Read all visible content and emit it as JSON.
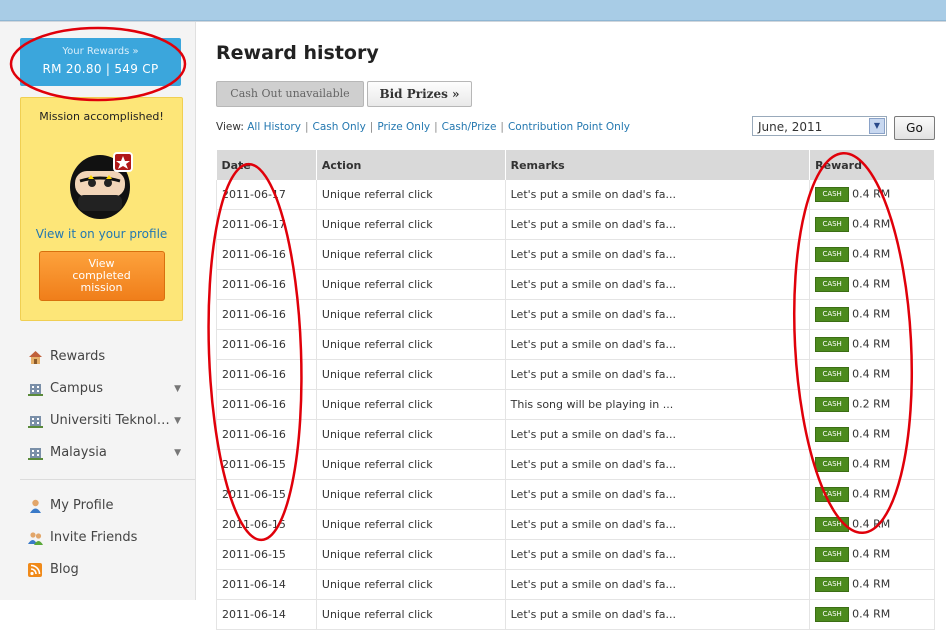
{
  "sidebar": {
    "rewards_label": "Your Rewards »",
    "rewards_value": "RM 20.80 | 549 CP",
    "mission_title": "Mission accomplished!",
    "view_profile": "View it on your profile",
    "view_mission_button": [
      "View",
      "completed",
      "mission"
    ],
    "nav": [
      {
        "label": "Rewards",
        "icon": "home-icon"
      },
      {
        "label": "Campus",
        "icon": "building-icon",
        "expandable": true
      },
      {
        "label": "Universiti Teknol…",
        "icon": "building-icon",
        "expandable": true
      },
      {
        "label": "Malaysia",
        "icon": "building-icon",
        "expandable": true
      }
    ],
    "nav2": [
      {
        "label": "My Profile",
        "icon": "user-icon"
      },
      {
        "label": "Invite Friends",
        "icon": "users-icon"
      },
      {
        "label": "Blog",
        "icon": "rss-icon"
      }
    ]
  },
  "main": {
    "title": "Reward history",
    "cashout_label": "Cash Out unavailable",
    "bid_label": "Bid Prizes »",
    "view_label": "View:",
    "filters": [
      "All History",
      "Cash Only",
      "Prize Only",
      "Cash/Prize",
      "Contribution Point Only"
    ],
    "month_value": "June, 2011",
    "go_label": "Go",
    "columns": [
      "Date",
      "Action",
      "Remarks",
      "Reward"
    ],
    "cash_badge": "CASH",
    "rows": [
      {
        "date": "2011-06-17",
        "action": "Unique referral click",
        "remarks": "Let's put a smile on dad's fa...",
        "reward": "0.4 RM"
      },
      {
        "date": "2011-06-17",
        "action": "Unique referral click",
        "remarks": "Let's put a smile on dad's fa...",
        "reward": "0.4 RM"
      },
      {
        "date": "2011-06-16",
        "action": "Unique referral click",
        "remarks": "Let's put a smile on dad's fa...",
        "reward": "0.4 RM"
      },
      {
        "date": "2011-06-16",
        "action": "Unique referral click",
        "remarks": "Let's put a smile on dad's fa...",
        "reward": "0.4 RM"
      },
      {
        "date": "2011-06-16",
        "action": "Unique referral click",
        "remarks": "Let's put a smile on dad's fa...",
        "reward": "0.4 RM"
      },
      {
        "date": "2011-06-16",
        "action": "Unique referral click",
        "remarks": "Let's put a smile on dad's fa...",
        "reward": "0.4 RM"
      },
      {
        "date": "2011-06-16",
        "action": "Unique referral click",
        "remarks": "Let's put a smile on dad's fa...",
        "reward": "0.4 RM"
      },
      {
        "date": "2011-06-16",
        "action": "Unique referral click",
        "remarks": "This song will be playing in ...",
        "reward": "0.2 RM"
      },
      {
        "date": "2011-06-16",
        "action": "Unique referral click",
        "remarks": "Let's put a smile on dad's fa...",
        "reward": "0.4 RM"
      },
      {
        "date": "2011-06-15",
        "action": "Unique referral click",
        "remarks": "Let's put a smile on dad's fa...",
        "reward": "0.4 RM"
      },
      {
        "date": "2011-06-15",
        "action": "Unique referral click",
        "remarks": "Let's put a smile on dad's fa...",
        "reward": "0.4 RM"
      },
      {
        "date": "2011-06-15",
        "action": "Unique referral click",
        "remarks": "Let's put a smile on dad's fa...",
        "reward": "0.4 RM"
      },
      {
        "date": "2011-06-15",
        "action": "Unique referral click",
        "remarks": "Let's put a smile on dad's fa...",
        "reward": "0.4 RM"
      },
      {
        "date": "2011-06-14",
        "action": "Unique referral click",
        "remarks": "Let's put a smile on dad's fa...",
        "reward": "0.4 RM"
      },
      {
        "date": "2011-06-14",
        "action": "Unique referral click",
        "remarks": "Let's put a smile on dad's fa...",
        "reward": "0.4 RM"
      }
    ]
  },
  "colors": {
    "accent_blue": "#3ba6dc",
    "mission_yellow": "#fde678",
    "orange_button": "#f07e1a",
    "cash_green": "#4c8a1e",
    "annotation_red": "#e0000a"
  }
}
